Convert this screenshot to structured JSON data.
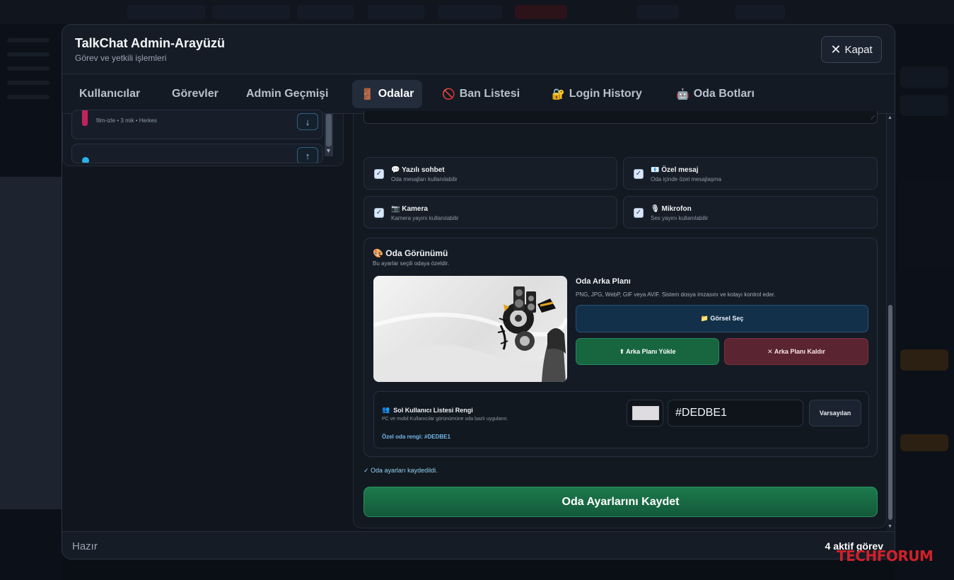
{
  "modal": {
    "title": "TalkChat Admin-Arayüzü",
    "subtitle": "Görev ve yetkili işlemleri",
    "close_label": "Kapat"
  },
  "tabs": [
    {
      "label": "Kullanıcılar",
      "icon": ""
    },
    {
      "label": "Görevler",
      "icon": ""
    },
    {
      "label": "Admin Geçmişi",
      "icon": ""
    },
    {
      "label": "Odalar",
      "icon": "🚪",
      "active": true
    },
    {
      "label": "Ban Listesi",
      "icon": "🚫"
    },
    {
      "label": "Login History",
      "icon": "🔐"
    },
    {
      "label": "Oda Botları",
      "icon": "🤖"
    }
  ],
  "rooms": [
    {
      "meta": "film-izle • 3 mik • Herkes",
      "arrow": "↓",
      "color": "#c0245c"
    },
    {
      "meta": "",
      "arrow": "↑",
      "color": "#2bb0e8"
    }
  ],
  "options": [
    {
      "icon": "💬",
      "title": "Yazılı sohbet",
      "desc": "Oda mesajları kullanılabilir",
      "checked": true
    },
    {
      "icon": "📧",
      "title": "Özel mesaj",
      "desc": "Oda içinde özel mesajlaşma",
      "checked": true
    },
    {
      "icon": "📷",
      "title": "Kamera",
      "desc": "Kamera yayını kullanılabilir",
      "checked": true
    },
    {
      "icon": "🎙",
      "title": "Mikrofon",
      "desc": "Ses yayını kullanılabilir",
      "checked": true
    }
  ],
  "appearance": {
    "icon": "🎨",
    "title": "Oda Görünümü",
    "subtitle": "Bu ayarlar seçili odaya özeldir.",
    "bg_label": "Oda Arka Planı",
    "bg_desc": "PNG, JPG, WebP, GIF veya AVIF. Sistem dosya imzasını ve kotayı kontrol eder.",
    "select_btn": "📁 Görsel Seç",
    "upload_btn": "⬆ Arka Planı Yükle",
    "remove_btn": "✕ Arka Planı Kaldır"
  },
  "color_settings": {
    "icon": "👥",
    "title": "Sol Kullanıcı Listesi Rengi",
    "desc": "PC ve mobil Kullanıcılar görünümüne oda bazlı uygulanır.",
    "note": "Özel oda rengi: #DEDBE1",
    "hex_value": "#DEDBE1",
    "swatch_color": "#DEDBE1",
    "default_btn": "Varsayılan"
  },
  "saved_message": "✓ Oda ayarları kaydedildi.",
  "save_button": "Oda Ayarlarını Kaydet",
  "footer": {
    "status": "Hazır",
    "active_tasks": "4 aktif görev"
  },
  "watermark": "TECHFORUM"
}
